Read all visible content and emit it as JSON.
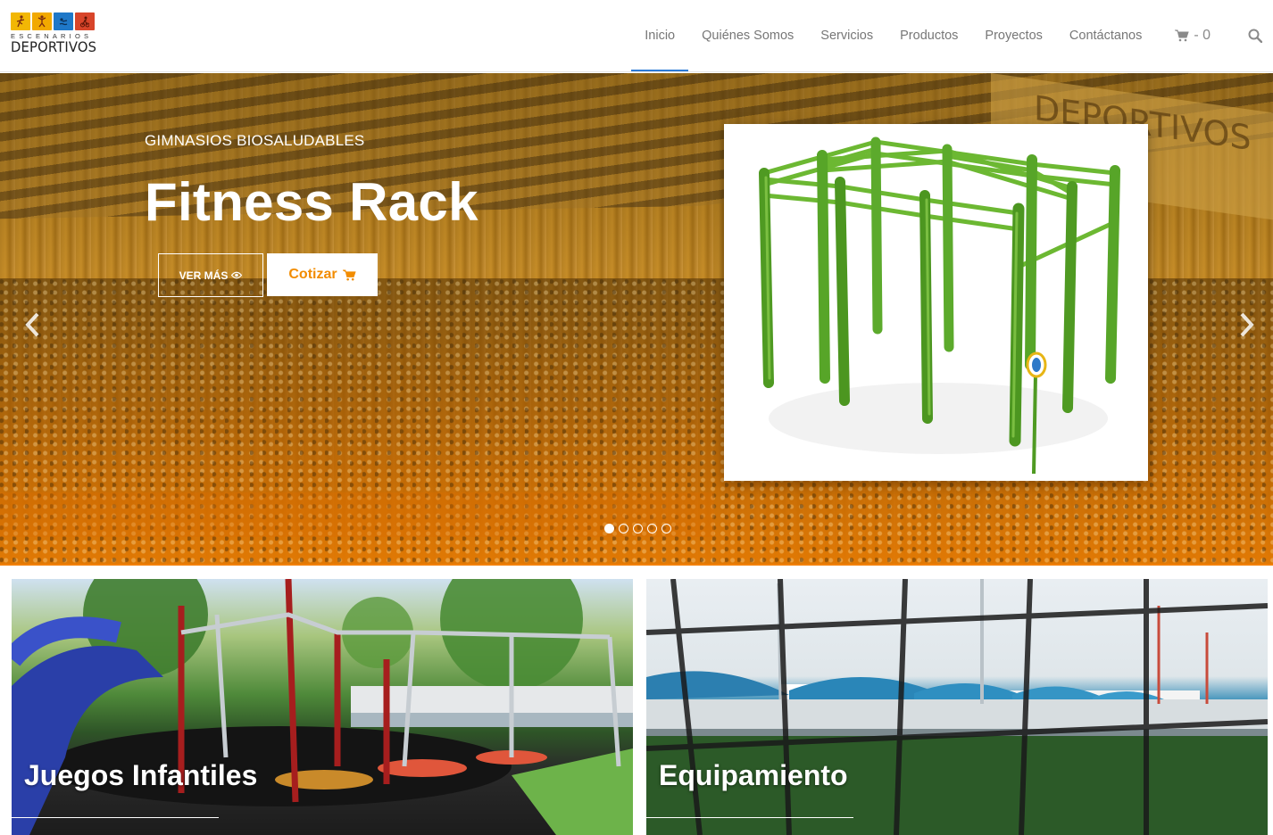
{
  "brand": {
    "logo_line1": "ESCENARIOS",
    "logo_line2": "DEPORTIVOS",
    "tile_colors": [
      "#f2b705",
      "#f2a900",
      "#1f78c8",
      "#d8452a"
    ]
  },
  "nav": {
    "items": [
      {
        "label": "Inicio",
        "active": true
      },
      {
        "label": "Quiénes Somos",
        "active": false
      },
      {
        "label": "Servicios",
        "active": false
      },
      {
        "label": "Productos",
        "active": false
      },
      {
        "label": "Proyectos",
        "active": false
      },
      {
        "label": "Contáctanos",
        "active": false
      }
    ],
    "cart_count": "- 0",
    "cart_icon": "shopping-cart-icon",
    "search_icon": "search-icon",
    "active_color": "#2c7ad6"
  },
  "hero": {
    "kicker": "GIMNASIOS BIOSALUDABLES",
    "title": "Fitness Rack",
    "more_label": "VER MÁS",
    "more_icon": "eye-icon",
    "quote_label": "Cotizar",
    "quote_icon": "shopping-cart-icon",
    "accent": "#f28c00",
    "sign_text": "DEPORTIVOS",
    "slide_count": 5,
    "active_slide": 1
  },
  "tiles": [
    {
      "title": "Juegos Infantiles"
    },
    {
      "title": "Equipamiento"
    }
  ]
}
